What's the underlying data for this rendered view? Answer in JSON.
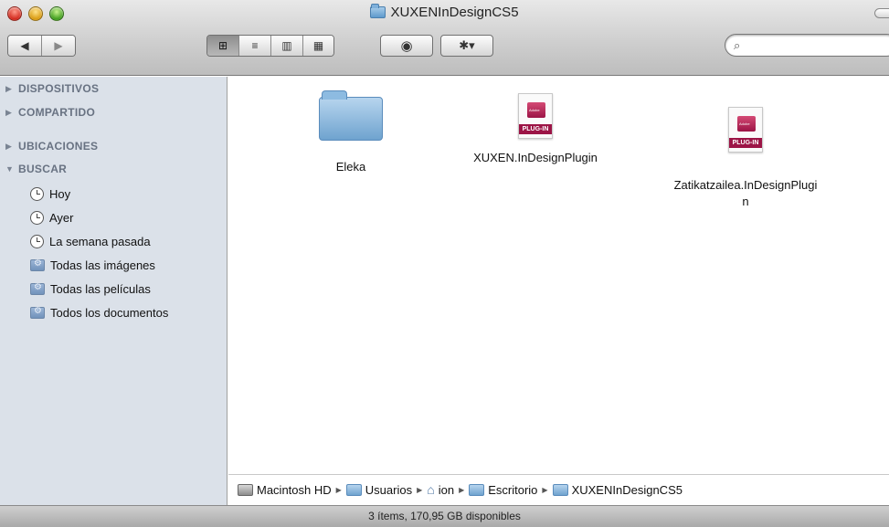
{
  "window": {
    "title": "XUXENInDesignCS5"
  },
  "toolbar": {
    "back": "◀",
    "forward": "▶",
    "views": [
      "⊞",
      "≡",
      "▥",
      "▦"
    ],
    "quicklook": "◉",
    "action": "✱▾",
    "search_placeholder": ""
  },
  "sidebar": {
    "groups": {
      "devices": "DISPOSITIVOS",
      "shared": "COMPARTIDO",
      "places": "UBICACIONES",
      "search": "BUSCAR"
    },
    "search_items": [
      {
        "label": "Hoy",
        "icon": "clock-icon"
      },
      {
        "label": "Ayer",
        "icon": "clock-icon"
      },
      {
        "label": "La semana pasada",
        "icon": "clock-icon"
      },
      {
        "label": "Todas las imágenes",
        "icon": "smart-folder-icon"
      },
      {
        "label": "Todas las películas",
        "icon": "smart-folder-icon"
      },
      {
        "label": "Todos los documentos",
        "icon": "smart-folder-icon"
      }
    ]
  },
  "files": [
    {
      "name": "Eleka",
      "type": "folder"
    },
    {
      "name": "XUXEN.InDesignPlugin",
      "type": "plugin",
      "badge": "PLUG-IN"
    },
    {
      "name": "Zatikatzailea.InDesignPlugi\nn",
      "type": "plugin",
      "badge": "PLUG-IN"
    }
  ],
  "pathbar": [
    "Macintosh HD",
    "Usuarios",
    "ion",
    "Escritorio",
    "XUXENInDesignCS5"
  ],
  "status": "3 ítems, 170,95 GB disponibles"
}
